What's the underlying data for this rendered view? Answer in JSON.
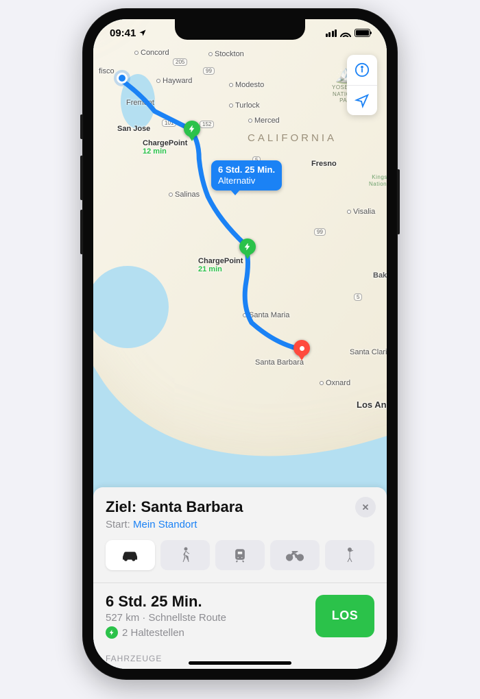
{
  "status": {
    "time": "09:41"
  },
  "map": {
    "region_label": "CALIFORNIA",
    "park_label": "YOSEMITE\nNATIONAL\nPARK",
    "park_label_2": "Kings\nNatione",
    "callout": {
      "line1": "6 Std. 25 Min.",
      "line2": "Alternativ"
    },
    "cities": {
      "concord": "Concord",
      "stockton": "Stockton",
      "fisco": "fisco",
      "hayward": "Hayward",
      "modesto": "Modesto",
      "fremont": "Fremont",
      "turlock": "Turlock",
      "merced": "Merced",
      "sanjose": "San Jose",
      "fresno": "Fresno",
      "salinas": "Salinas",
      "visalia": "Visalia",
      "santamaria": "Santa Maria",
      "bak": "Bak",
      "santabarbara": "Santa Barbara",
      "santaclarit": "Santa Clarit",
      "oxnard": "Oxnard",
      "losang": "Los Ang"
    },
    "charge1": {
      "name": "ChargePoint",
      "time": "12 min"
    },
    "charge2": {
      "name": "ChargePoint",
      "time": "21 min"
    }
  },
  "directions": {
    "destination_prefix": "Ziel: ",
    "destination": "Santa Barbara",
    "start_label": "Start:",
    "start_value": "Mein Standort",
    "eta": "6 Std. 25 Min.",
    "distance_route": "527 km · Schnellste Route",
    "stops": "2 Haltestellen",
    "go": "LOS",
    "section": "FAHRZEUGE"
  }
}
